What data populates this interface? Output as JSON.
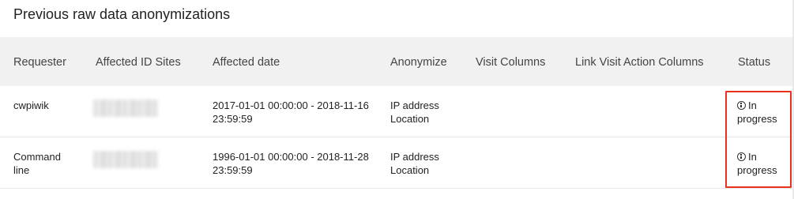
{
  "panel": {
    "title": "Previous raw data anonymizations"
  },
  "table": {
    "headers": {
      "requester": "Requester",
      "sites": "Affected ID Sites",
      "date": "Affected date",
      "anonymize": "Anonymize",
      "visit_columns": "Visit Columns",
      "link_visit_action_columns": "Link Visit Action Columns",
      "status": "Status"
    },
    "rows": [
      {
        "requester": "cwpiwik",
        "date": "2017-01-01 00:00:00 - 2018-11-16 23:59:59",
        "anonymize_1": "IP address",
        "anonymize_2": "Location",
        "status_icon": "info-icon",
        "status_1": "In",
        "status_2": "progress"
      },
      {
        "requester": "Command line",
        "date": "1996-01-01 00:00:00 - 2018-11-28 23:59:59",
        "anonymize_1": "IP address",
        "anonymize_2": "Location",
        "status_icon": "info-icon",
        "status_1": "In",
        "status_2": "progress"
      }
    ]
  },
  "colors": {
    "header_bg": "#f1f1f2",
    "highlight": "#e8321c"
  }
}
